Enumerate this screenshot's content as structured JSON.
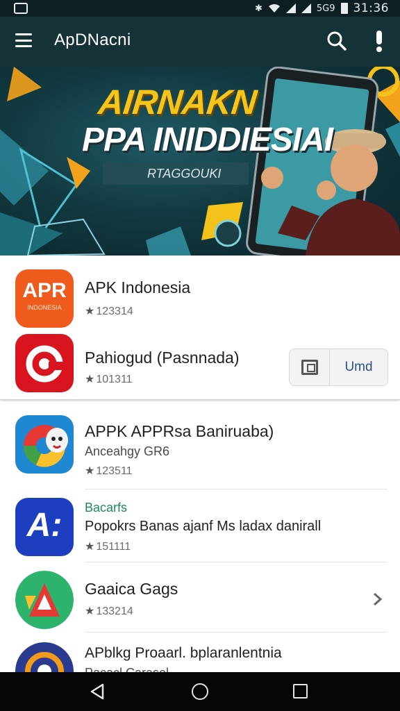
{
  "status_bar": {
    "signal_text": "5G9",
    "time": "31:36"
  },
  "app_bar": {
    "title": "ApDNacni",
    "icons": [
      "menu-icon",
      "search-icon",
      "info-icon"
    ]
  },
  "banner": {
    "headline1": "AIRNAKN",
    "headline2": "PPA INIDDIESIAI",
    "subtitle": "RTAGGOUKI"
  },
  "featured": [
    {
      "name": "APK Indonesia",
      "rating": "123314",
      "icon": "apr-logo-icon",
      "icon_text": "APR",
      "icon_subtext": "INDONESIA"
    },
    {
      "name": "Pahiogud (Pasnnada)",
      "rating": "101311",
      "icon": "red-ring-logo-icon"
    }
  ],
  "featured_action": {
    "label": "Umd",
    "icon": "window-icon"
  },
  "apps": [
    {
      "name": "APPK APPRsa Baniruaba)",
      "subtitle": "Anceahgy GR6",
      "rating": "123511",
      "icon": "chrome-face-logo-icon"
    },
    {
      "name": "Popokrs Banas ajanf Ms ladax danirall",
      "tag": "Bacarfs",
      "rating": "151111",
      "icon": "a-letter-logo-icon"
    },
    {
      "name": "Gaaica Gags",
      "rating": "133214",
      "icon": "green-triangle-logo-icon"
    },
    {
      "name": "APblkg Proaarl. bplaranlentnia",
      "subtitle": "Pacacl Carasol",
      "icon": "orange-circle-logo-icon"
    }
  ],
  "colors": {
    "app_bar": "#153336",
    "status_bar": "#0d1f22",
    "banner_title": "#f6c51b",
    "tag_green": "#1a8a5a",
    "action_text": "#2d4f88",
    "nav_bar": "#050505"
  }
}
